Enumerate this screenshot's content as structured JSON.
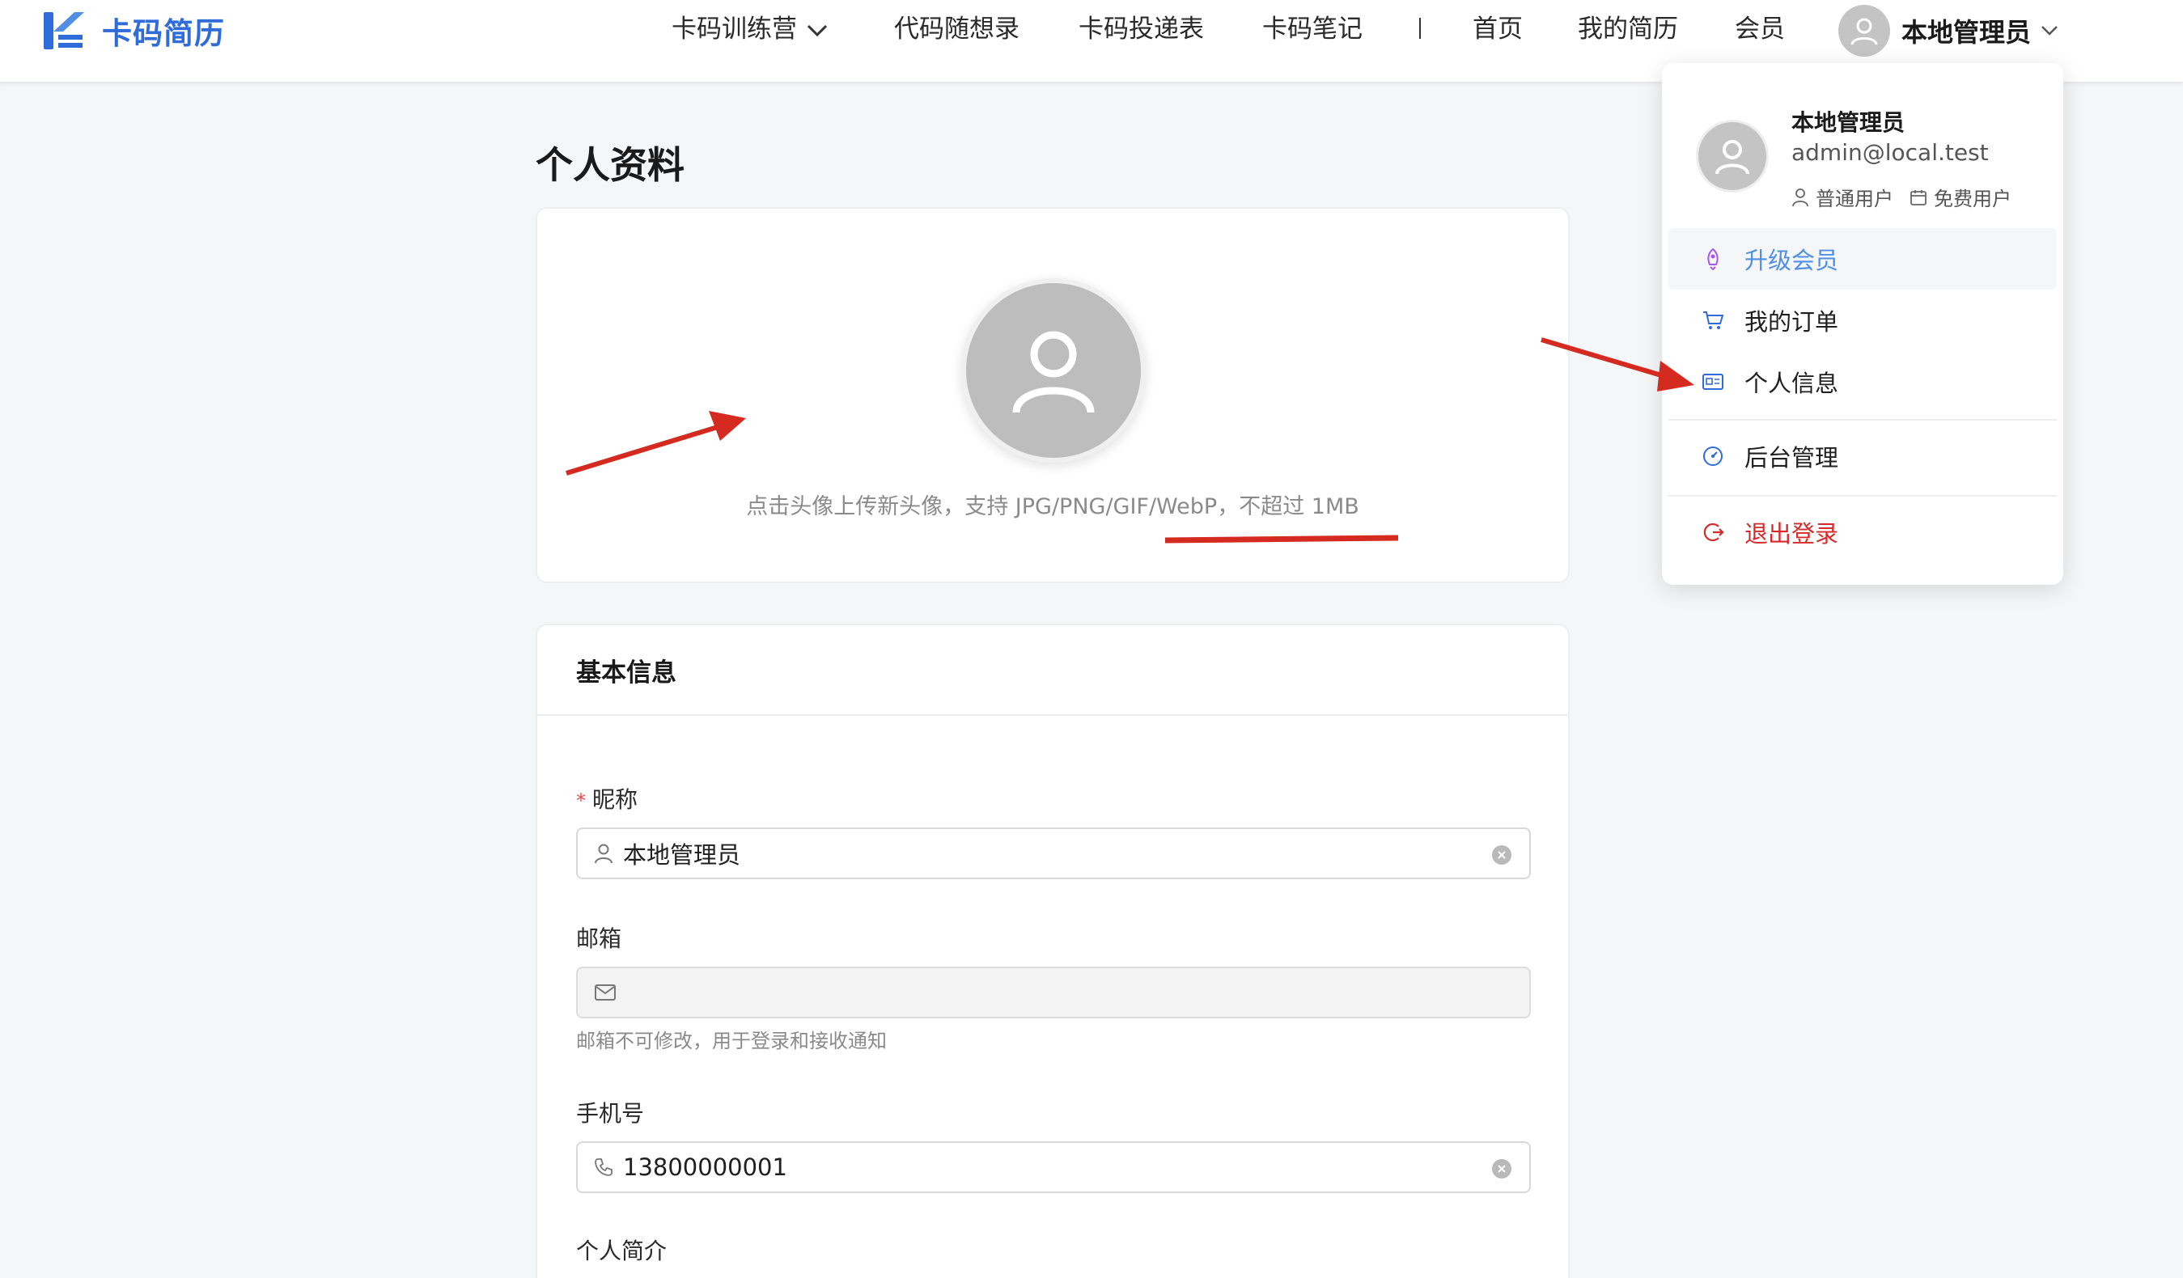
{
  "header": {
    "logo_text": "卡码简历",
    "nav": [
      {
        "label": "卡码训练营",
        "has_dropdown": true
      },
      {
        "label": "代码随想录"
      },
      {
        "label": "卡码投递表"
      },
      {
        "label": "卡码笔记"
      },
      {
        "label": "首页"
      },
      {
        "label": "我的简历"
      },
      {
        "label": "会员"
      }
    ],
    "user_name": "本地管理员"
  },
  "page": {
    "title": "个人资料",
    "avatar_hint": "点击头像上传新头像，支持 JPG/PNG/GIF/WebP，不超过 1MB"
  },
  "basic_info": {
    "heading": "基本信息",
    "nickname_label": "昵称",
    "nickname_required_mark": "*",
    "nickname_value": "本地管理员",
    "email_label": "邮箱",
    "email_value": "",
    "email_help": "邮箱不可修改，用于登录和接收通知",
    "phone_label": "手机号",
    "phone_value": "13800000001",
    "bio_label": "个人简介"
  },
  "dropdown": {
    "name": "本地管理员",
    "email": "admin@local.test",
    "tags": [
      "普通用户",
      "免费用户"
    ],
    "items": [
      {
        "label": "升级会员",
        "icon": "rocket-icon",
        "active": true
      },
      {
        "label": "我的订单",
        "icon": "cart-icon"
      },
      {
        "label": "个人信息",
        "icon": "id-card-icon"
      },
      {
        "label": "后台管理",
        "icon": "dashboard-icon"
      },
      {
        "label": "退出登录",
        "icon": "logout-icon",
        "danger": true
      }
    ]
  },
  "colors": {
    "brand": "#2f6bd9",
    "active_item": "#4f8fe6",
    "danger": "#d42a2a",
    "annotation": "#d42a1f",
    "required": "#e5484d"
  }
}
